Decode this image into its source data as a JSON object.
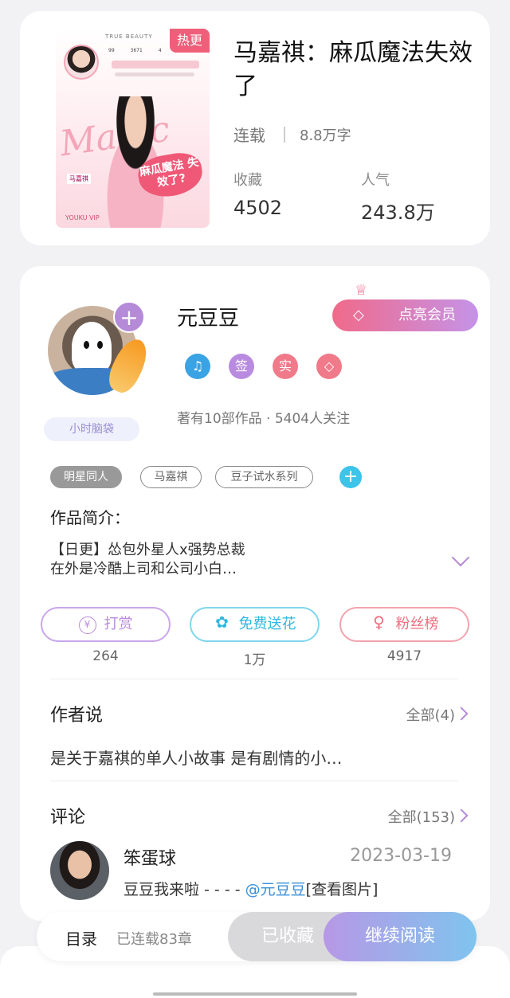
{
  "book": {
    "cover": {
      "hot_badge": "热更",
      "brand": "TRUE BEAUTY",
      "stats": "99 3671 4",
      "magic_word": "Magic",
      "sticker": "麻瓜魔法 失效了?",
      "name_tag": "马嘉祺",
      "youku": "YOUKU VIP"
    },
    "title": "马嘉祺：麻瓜魔法失效了",
    "status": "连载",
    "word_count": "8.8万字",
    "favorites_label": "收藏",
    "favorites_value": "4502",
    "popularity_label": "人气",
    "popularity_value": "243.8万"
  },
  "author": {
    "name": "元豆豆",
    "plus": "+",
    "nick_badge": "小时脑袋",
    "vip_button": "点亮会员",
    "badges": [
      {
        "icon": "medal-icon",
        "text": "♫",
        "color": "#3aa3e3"
      },
      {
        "icon": "sign-icon",
        "text": "签",
        "color": "#b98be0"
      },
      {
        "icon": "verified-icon",
        "text": "实",
        "color": "#f07a8a"
      },
      {
        "icon": "diamond-icon",
        "text": "◇",
        "color": "#f07a8a"
      }
    ],
    "meta": "著有10部作品 · 5404人关注",
    "tags": [
      "明星同人",
      "马嘉祺",
      "豆子试水系列"
    ],
    "tag_add": "+"
  },
  "intro": {
    "title": "作品简介：",
    "line1": "【日更】怂包外星人x强势总裁",
    "line2": "在外是冷酷上司和公司小白…"
  },
  "actions": [
    {
      "label": "打赏",
      "count": "264",
      "icon": "¥",
      "color": "#b98be0"
    },
    {
      "label": "免费送花",
      "count": "1万",
      "icon": "✿",
      "color": "#43c3e6"
    },
    {
      "label": "粉丝榜",
      "count": "4917",
      "icon": "♀",
      "color": "#f07a8a"
    }
  ],
  "author_says": {
    "title": "作者说",
    "all": "全部(4)",
    "text": "是关于嘉祺的单人小故事 是有剧情的小…"
  },
  "comments": {
    "title": "评论",
    "all": "全部(153)",
    "user": "笨蛋球",
    "date": "2023-03-19",
    "text_before": "豆豆我来啦 - - - - ",
    "mention": "@元豆豆",
    "text_after": "[查看图片]"
  },
  "bottom": {
    "toc": "目录",
    "chapters": "已连载83章",
    "faved": "已收藏",
    "read": "继续阅读"
  }
}
